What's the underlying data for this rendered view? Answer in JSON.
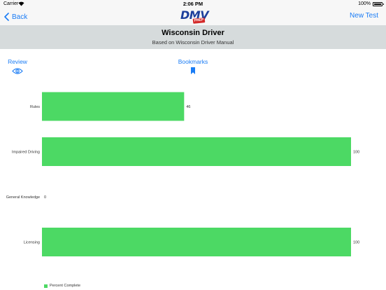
{
  "status_bar": {
    "carrier": "Carrier",
    "time": "2:06 PM",
    "battery": "100%"
  },
  "nav": {
    "back_label": "Back",
    "logo_text": "DMV",
    "logo_badge": "PREP",
    "new_test_label": "New Test"
  },
  "header": {
    "title": "Wisconsin Driver",
    "subtitle": "Based on Wisconsin Driver Manual"
  },
  "links": {
    "review_label": "Review",
    "bookmarks_label": "Bookmarks"
  },
  "colors": {
    "accent": "#1a7cf5",
    "bar": "#4cd964",
    "header_band": "#d6dbdc"
  },
  "chart_data": {
    "type": "bar",
    "orientation": "horizontal",
    "categories": [
      "Rules",
      "Impaired Driving",
      "General Knowledge",
      "Licensing"
    ],
    "series": [
      {
        "name": "Percent Complete",
        "values": [
          46,
          100,
          0,
          100
        ]
      }
    ],
    "xlim": [
      0,
      100
    ],
    "grid": false,
    "legend": "bottom-left"
  }
}
